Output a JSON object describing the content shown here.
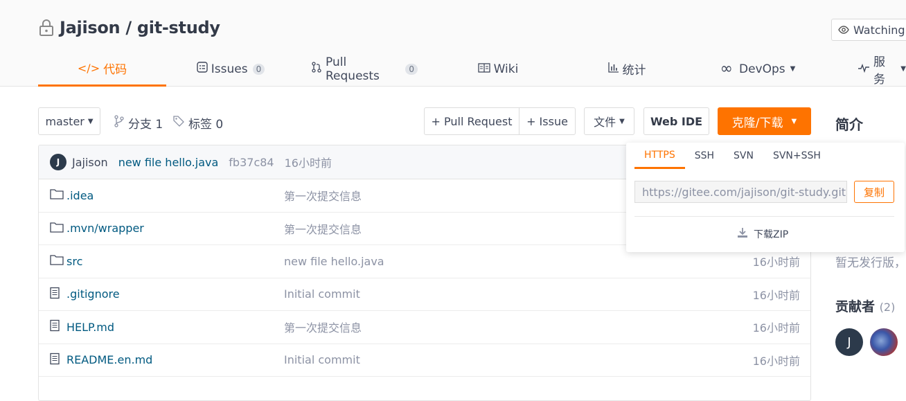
{
  "repo": {
    "title": "Jajison / git-study",
    "watch_label": "Watching"
  },
  "tabs": [
    {
      "label": "代码"
    },
    {
      "label": "Issues",
      "count": "0"
    },
    {
      "label": "Pull Requests",
      "count": "0"
    },
    {
      "label": "Wiki"
    },
    {
      "label": "统计"
    },
    {
      "label": "DevOps"
    },
    {
      "label": "服务"
    }
  ],
  "toolbar": {
    "branch": "master",
    "branches": "分支 1",
    "tags": "标签 0",
    "pull_request": "+ Pull Request",
    "issue": "+ Issue",
    "file": "文件",
    "web_ide": "Web IDE",
    "clone": "克隆/下载"
  },
  "commit": {
    "avatar": "J",
    "author": "Jajison",
    "message": "new file hello.java",
    "hash": "fb37c84",
    "time": "16小时前"
  },
  "files": [
    {
      "name": ".idea",
      "type": "folder",
      "message": "第一次提交信息",
      "time": ""
    },
    {
      "name": ".mvn/wrapper",
      "type": "folder",
      "message": "第一次提交信息",
      "time": ""
    },
    {
      "name": "src",
      "type": "folder",
      "message": "new file hello.java",
      "time": "16小时前"
    },
    {
      "name": ".gitignore",
      "type": "file",
      "message": "Initial commit",
      "time": "16小时前"
    },
    {
      "name": "HELP.md",
      "type": "file",
      "message": "第一次提交信息",
      "time": "16小时前"
    },
    {
      "name": "README.en.md",
      "type": "file",
      "message": "Initial commit",
      "time": "16小时前"
    }
  ],
  "clone_popup": {
    "tabs": [
      "HTTPS",
      "SSH",
      "SVN",
      "SVN+SSH"
    ],
    "url": "https://gitee.com/jajison/git-study.git",
    "copy_label": "复制",
    "zip_label": "下载ZIP"
  },
  "sidebar": {
    "intro_title": "简介",
    "release_text": "暂无发行版，",
    "contributors_title": "贡献者",
    "contributors_count": "(2)",
    "contributor_avatar": "J"
  },
  "colors": {
    "accent": "#fe7300",
    "link": "#005980",
    "muted": "#8c92a4"
  }
}
